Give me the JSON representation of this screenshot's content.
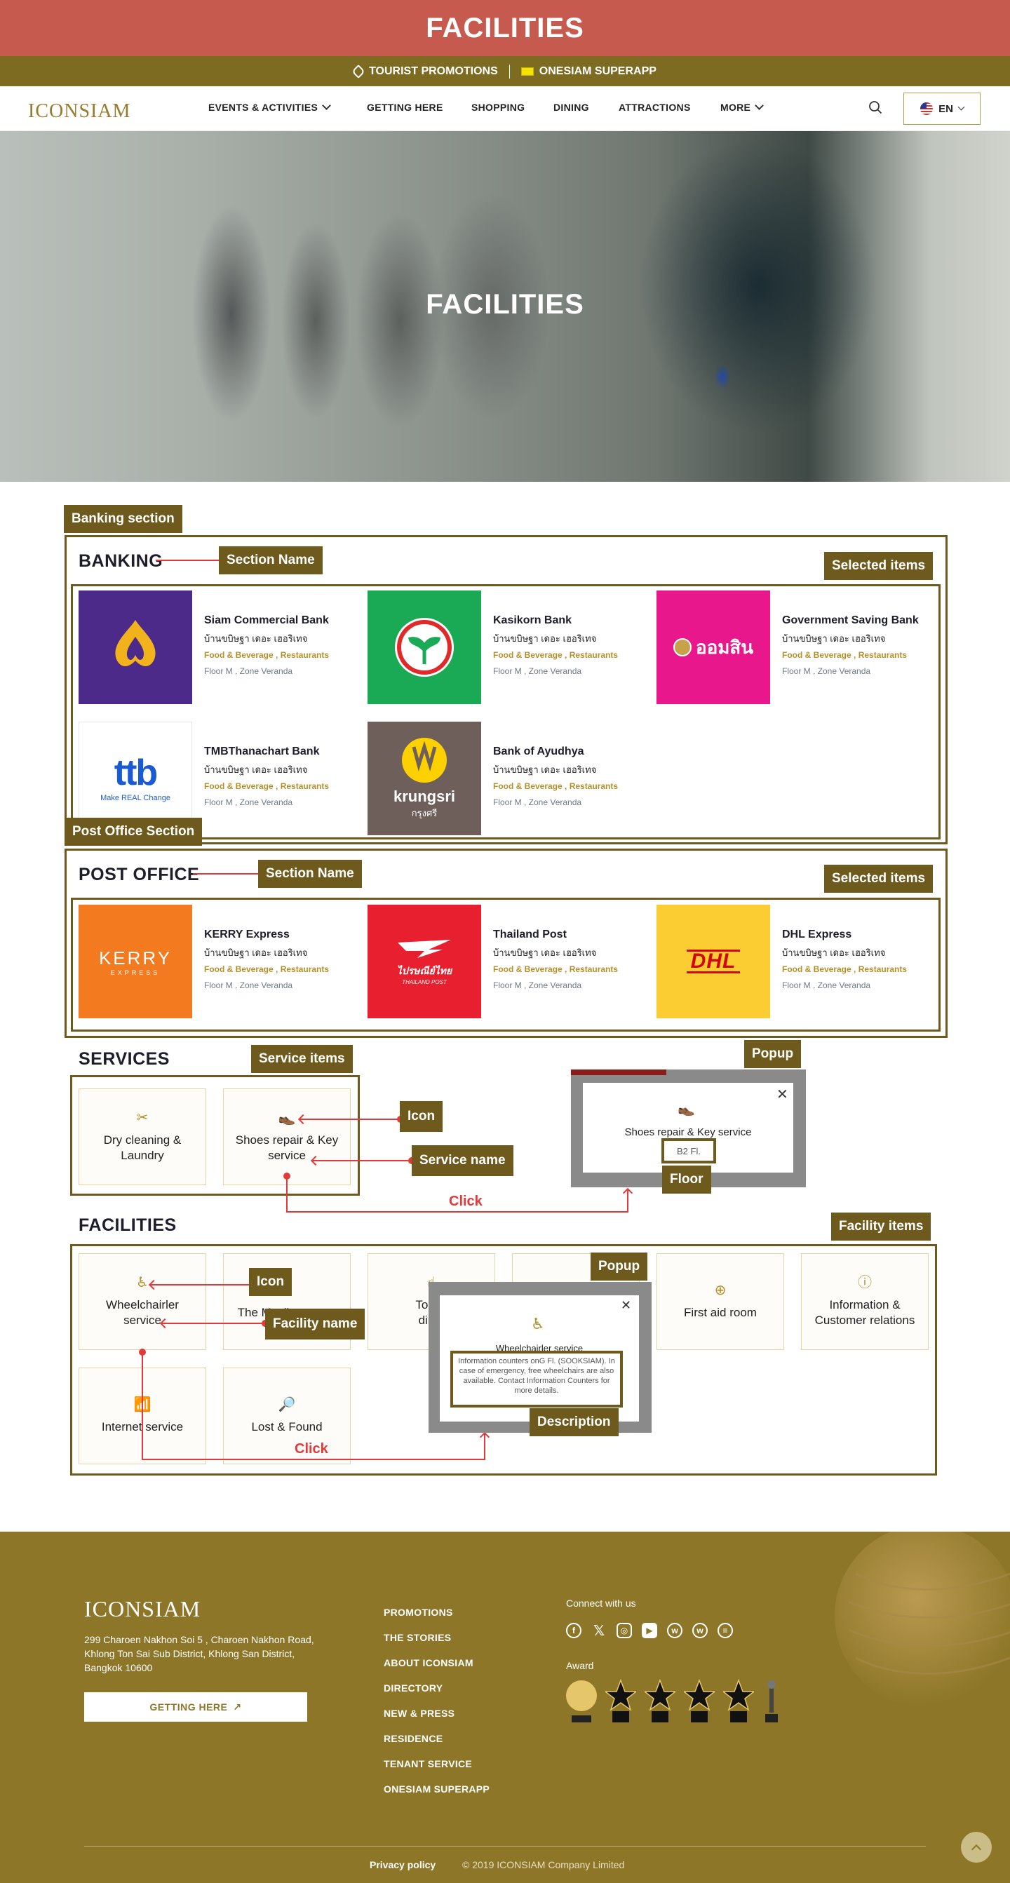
{
  "page": {
    "title_bar": "FACILITIES",
    "promos": [
      "TOURIST PROMOTIONS",
      "ONESIAM SUPERAPP"
    ]
  },
  "nav": {
    "logo": "ICONSIAM",
    "items": [
      "EVENTS & ACTIVITIES",
      "GETTING HERE",
      "SHOPPING",
      "DINING",
      "ATTRACTIONS",
      "MORE"
    ],
    "lang": "EN"
  },
  "hero": {
    "title": "FACILITIES"
  },
  "annotations": {
    "banking_section": "Banking section",
    "post_office_section": "Post Office Section",
    "section_name": "Section Name",
    "selected_items": "Selected items",
    "service_items": "Service items",
    "popup": "Popup",
    "icon": "Icon",
    "service_name": "Service name",
    "floor": "Floor",
    "click": "Click",
    "facility_items": "Facility items",
    "facility_name": "Facility name",
    "description": "Description"
  },
  "banking": {
    "title": "BANKING",
    "stores": [
      {
        "name": "Siam Commercial Bank",
        "sub": "บ้านขบิษฐา เดอะ เฮอริเทจ",
        "cat": "Food & Beverage , Restaurants",
        "floor": "Floor M , Zone Veranda",
        "color": "#4b2a8a"
      },
      {
        "name": "Kasikorn Bank",
        "sub": "บ้านขบิษฐา เดอะ เฮอริเทจ",
        "cat": "Food & Beverage , Restaurants",
        "floor": "Floor M , Zone Veranda",
        "color": "#1aaa55"
      },
      {
        "name": "Government Saving Bank",
        "sub": "บ้านขบิษฐา เดอะ เฮอริเทจ",
        "cat": "Food & Beverage , Restaurants",
        "floor": "Floor M , Zone Veranda",
        "color": "#e8188c",
        "logo_text": "ออมสิน"
      },
      {
        "name": "TMBThanachart Bank",
        "sub": "บ้านขบิษฐา เดอะ เฮอริเทจ",
        "cat": "Food & Beverage , Restaurants",
        "floor": "Floor M , Zone Veranda",
        "color": "#ffffff",
        "logo_text": "ttb",
        "logo_sub": "Make REAL Change"
      },
      {
        "name": "Bank of Ayudhya",
        "sub": "บ้านขบิษฐา เดอะ เฮอริเทจ",
        "cat": "Food & Beverage , Restaurants",
        "floor": "Floor M , Zone Veranda",
        "color": "#6e5f5b",
        "logo_text": "krungsri",
        "logo_sub": "กรุงศรี"
      }
    ]
  },
  "post_office": {
    "title": "POST OFFICE",
    "stores": [
      {
        "name": "KERRY Express",
        "sub": "บ้านขบิษฐา เดอะ เฮอริเทจ",
        "cat": "Food & Beverage , Restaurants",
        "floor": "Floor M , Zone Veranda",
        "color": "#f47a20",
        "logo_text": "KERRY",
        "logo_sub": "EXPRESS"
      },
      {
        "name": "Thailand Post",
        "sub": "บ้านขบิษฐา เดอะ เฮอริเทจ",
        "cat": "Food & Beverage , Restaurants",
        "floor": "Floor M , Zone Veranda",
        "color": "#e81f2e",
        "logo_text": "ไปรษณีย์ไทย",
        "logo_sub": "THAILAND POST"
      },
      {
        "name": "DHL Express",
        "sub": "บ้านขบิษฐา เดอะ เฮอริเทจ",
        "cat": "Food & Beverage , Restaurants",
        "floor": "Floor M , Zone Veranda",
        "color": "#fccc33",
        "logo_text": "DHL"
      }
    ]
  },
  "services": {
    "title": "SERVICES",
    "items": [
      {
        "name": "Dry cleaning & Laundry",
        "icon": "shirt-icon"
      },
      {
        "name": "Shoes repair & Key service",
        "icon": "shoe-icon"
      }
    ],
    "popup": {
      "name": "Shoes repair & Key service",
      "floor": "B2 Fl."
    }
  },
  "facilities": {
    "title": "FACILITIES",
    "items": [
      {
        "name": "Wheelchairler service",
        "icon": "wheelchair-icon"
      },
      {
        "name": "The Muslim prayer",
        "icon": "prayer-icon"
      },
      {
        "name": "Touch",
        "name2": "direc",
        "icon": "touch-icon"
      },
      {
        "name": "",
        "icon": ""
      },
      {
        "name": "First aid room",
        "icon": "first-aid-icon"
      },
      {
        "name": "Information & Customer relations",
        "icon": "info-icon"
      },
      {
        "name": "Internet service",
        "icon": "wifi-icon"
      },
      {
        "name": "Lost & Found",
        "icon": "lost-found-icon"
      }
    ],
    "popup": {
      "name": "Wheelchairler service",
      "description": "Information counters onG Fl. (SOOKSIAM). In case of emergency, free wheelchairs are also available. Contact Information Counters for more details."
    }
  },
  "footer": {
    "logo": "ICONSIAM",
    "address": "299 Charoen Nakhon Soi 5 , Charoen Nakhon Road, Khlong Ton Sai Sub District, Khlong San District, Bangkok 10600",
    "getting_here": "GETTING HERE",
    "links": [
      "PROMOTIONS",
      "THE STORIES",
      "ABOUT ICONSIAM",
      "DIRECTORY",
      "NEW & PRESS",
      "RESIDENCE",
      "TENANT SERVICE",
      "ONESIAM SUPERAPP"
    ],
    "connect": "Connect with us",
    "award": "Award",
    "privacy": "Privacy policy",
    "copyright": "© 2019 ICONSIAM Company Limited"
  }
}
